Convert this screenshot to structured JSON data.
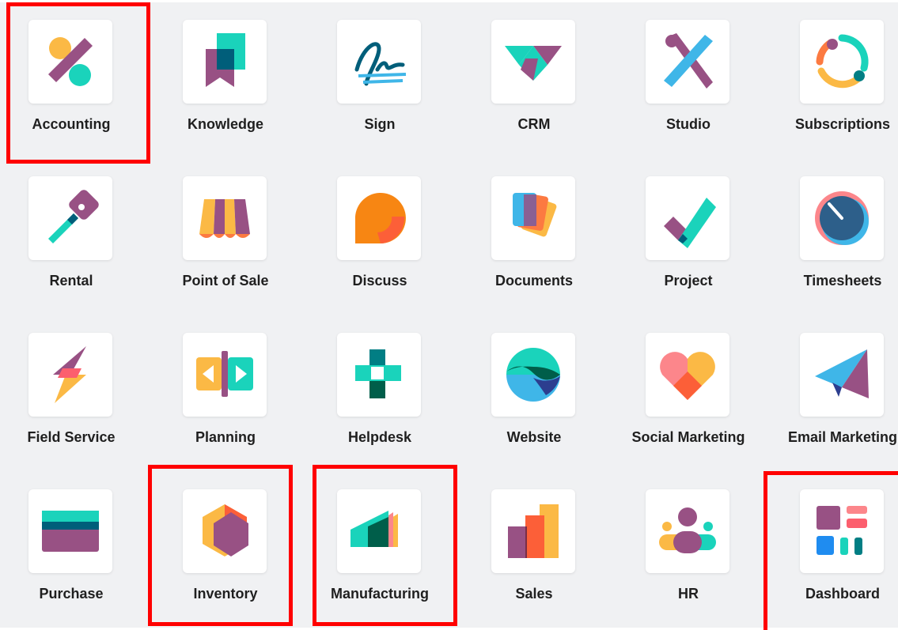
{
  "apps": [
    {
      "label": "Accounting",
      "icon": "accounting-icon"
    },
    {
      "label": "Knowledge",
      "icon": "knowledge-icon"
    },
    {
      "label": "Sign",
      "icon": "sign-icon"
    },
    {
      "label": "CRM",
      "icon": "crm-icon"
    },
    {
      "label": "Studio",
      "icon": "studio-icon"
    },
    {
      "label": "Subscriptions",
      "icon": "subscriptions-icon"
    },
    {
      "label": "Rental",
      "icon": "rental-icon"
    },
    {
      "label": "Point of Sale",
      "icon": "point-of-sale-icon"
    },
    {
      "label": "Discuss",
      "icon": "discuss-icon"
    },
    {
      "label": "Documents",
      "icon": "documents-icon"
    },
    {
      "label": "Project",
      "icon": "project-icon"
    },
    {
      "label": "Timesheets",
      "icon": "timesheets-icon"
    },
    {
      "label": "Field Service",
      "icon": "field-service-icon"
    },
    {
      "label": "Planning",
      "icon": "planning-icon"
    },
    {
      "label": "Helpdesk",
      "icon": "helpdesk-icon"
    },
    {
      "label": "Website",
      "icon": "website-icon"
    },
    {
      "label": "Social Marketing",
      "icon": "social-marketing-icon"
    },
    {
      "label": "Email Marketing",
      "icon": "email-marketing-icon"
    },
    {
      "label": "Purchase",
      "icon": "purchase-icon"
    },
    {
      "label": "Inventory",
      "icon": "inventory-icon"
    },
    {
      "label": "Manufacturing",
      "icon": "manufacturing-icon"
    },
    {
      "label": "Sales",
      "icon": "sales-icon"
    },
    {
      "label": "HR",
      "icon": "hr-icon"
    },
    {
      "label": "Dashboard",
      "icon": "dashboard-icon"
    }
  ],
  "highlighted_apps": [
    "Accounting",
    "Inventory",
    "Manufacturing",
    "Dashboard"
  ],
  "colors": {
    "highlight": "#ff0000",
    "background": "#f0f1f3",
    "purple": "#985184",
    "teal": "#1ad3bb",
    "orange": "#fc868b",
    "yellow": "#fbb945",
    "dark_teal": "#005e7a"
  }
}
